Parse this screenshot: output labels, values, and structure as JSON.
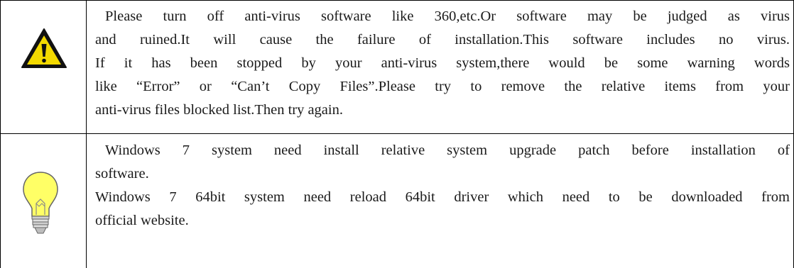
{
  "notices": [
    {
      "icon": "warning-triangle-icon",
      "lines": [
        "Please turn off anti-virus software like 360,etc.Or software may be judged as virus",
        "and ruined.It will cause the failure of installation.This software includes no virus.",
        "If it has been stopped by your anti-virus system,there would be some warning words",
        "like “Error” or “Can’t Copy Files”.Please try to remove the relative items from your",
        "anti-virus files blocked list.Then try again."
      ]
    },
    {
      "icon": "lightbulb-icon",
      "lines": [
        "Windows 7 system need install relative system upgrade patch before installation of",
        "software.",
        "Windows 7 64bit system need reload 64bit driver which need to be downloaded from",
        "official website."
      ]
    }
  ],
  "colors": {
    "warning_fill": "#f3d900",
    "bulb_fill": "#ffff66",
    "border": "#000000"
  }
}
